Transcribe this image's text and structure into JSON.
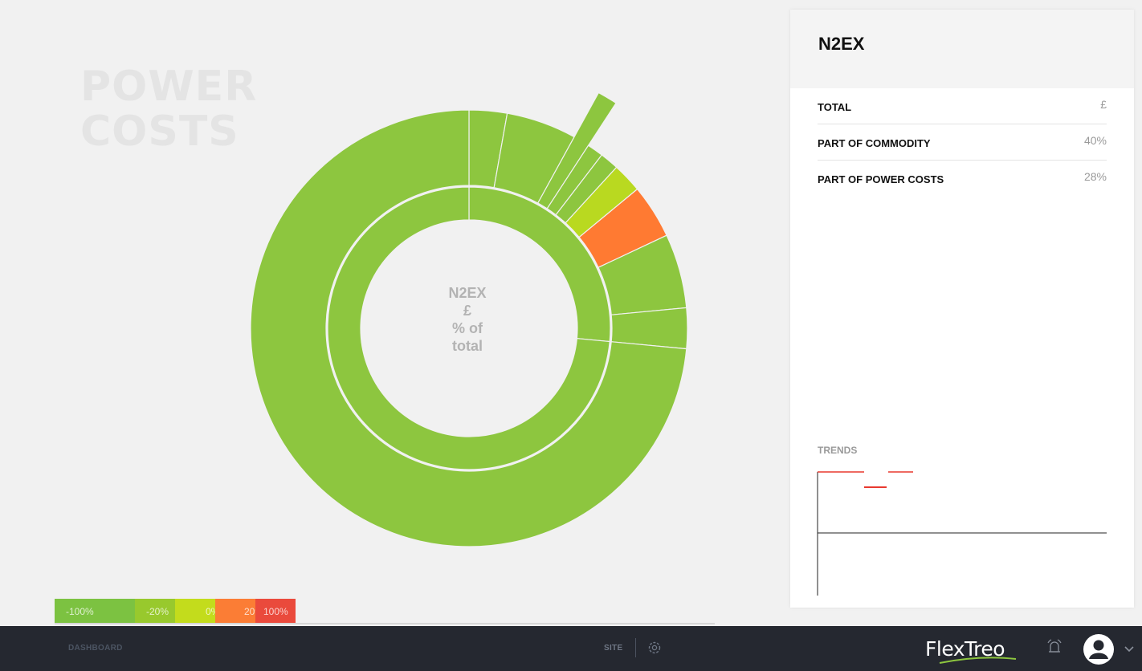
{
  "page": {
    "title_line1": "POWER",
    "title_line2": "COSTS"
  },
  "sunburst": {
    "center_name": "N2EX",
    "center_currency": "£",
    "center_pct_line1": "% of",
    "center_pct_line2": "total",
    "inner_ring": [
      {
        "name": "segment-a",
        "value": 0.265,
        "color": "#8dc63f"
      },
      {
        "name": "segment-b",
        "value": 0.735,
        "color": "#8dc63f"
      }
    ],
    "outer_ring": [
      {
        "name": "slice-1",
        "value": 0.028,
        "color": "#8dc63f",
        "extended": false
      },
      {
        "name": "slice-2",
        "value": 0.052,
        "color": "#8dc63f",
        "extended": false
      },
      {
        "name": "slice-3",
        "value": 0.012,
        "color": "#8dc63f",
        "extended": true
      },
      {
        "name": "slice-4",
        "value": 0.012,
        "color": "#8dc63f",
        "extended": false
      },
      {
        "name": "slice-5",
        "value": 0.014,
        "color": "#8dc63f",
        "extended": false
      },
      {
        "name": "slice-6",
        "value": 0.022,
        "color": "#b9d920",
        "extended": false
      },
      {
        "name": "slice-7",
        "value": 0.04,
        "color": "#ff7a32",
        "extended": false
      },
      {
        "name": "slice-8",
        "value": 0.055,
        "color": "#8dc63f",
        "extended": false
      },
      {
        "name": "slice-9",
        "value": 0.03,
        "color": "#8dc63f",
        "extended": false
      },
      {
        "name": "slice-10",
        "value": 0.735,
        "color": "#8dc63f",
        "extended": false
      }
    ]
  },
  "legend": [
    {
      "label": "-100%",
      "color": "#7cc241"
    },
    {
      "label": "-20%",
      "color": "#98c92d"
    },
    {
      "label": "0%",
      "color": "#c3dc1c"
    },
    {
      "label": "20%",
      "color": "#fb7d35"
    },
    {
      "label": "100%",
      "color": "#ea4a3c"
    }
  ],
  "panel": {
    "title": "N2EX",
    "rows": [
      {
        "label": "TOTAL",
        "value": "£"
      },
      {
        "label": "PART OF COMMODITY",
        "value": "40%"
      },
      {
        "label": "PART OF POWER COSTS",
        "value": "28%"
      }
    ],
    "trends_label": "TRENDS"
  },
  "nav": {
    "dashboard_label": "DASHBOARD",
    "site_label": "SITE",
    "brand": "FlexTreo",
    "icons": [
      "gear-icon",
      "bell-icon",
      "avatar-icon",
      "chevron-down-icon"
    ]
  },
  "colors": {
    "accent_green": "#8dc63f",
    "lime": "#b9d920",
    "orange": "#ff7a32",
    "red": "#ea4a3c",
    "navbar": "#252830",
    "trend_red": "#e8392f"
  }
}
